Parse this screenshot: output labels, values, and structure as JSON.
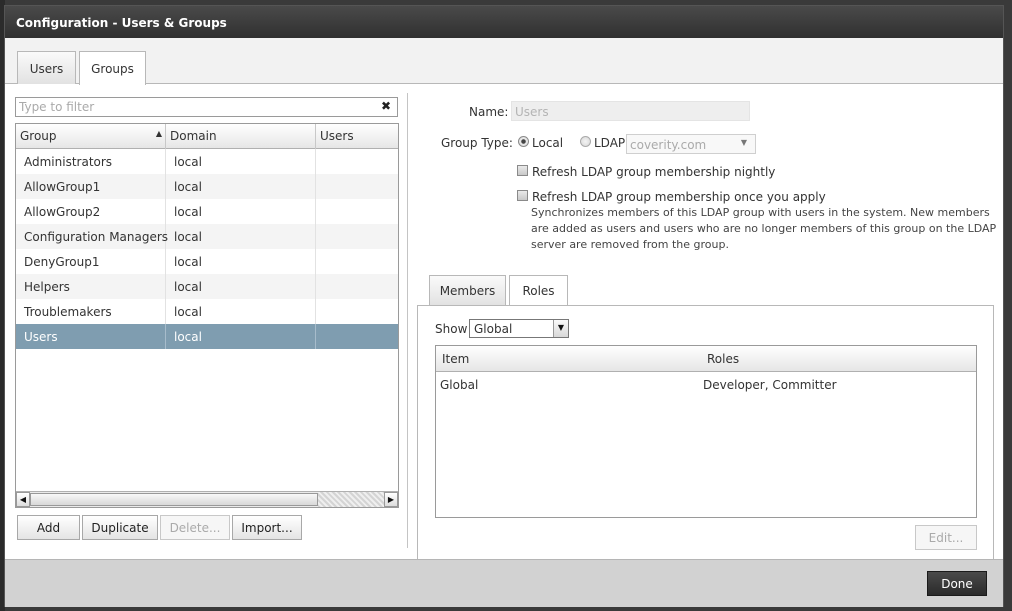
{
  "window": {
    "title": "Configuration - Users & Groups"
  },
  "tabs": [
    {
      "label": "Users",
      "active": false
    },
    {
      "label": "Groups",
      "active": true
    }
  ],
  "filter": {
    "placeholder": "Type to filter",
    "value": "",
    "clear_icon": "close-icon"
  },
  "groups_table": {
    "columns": [
      "Group",
      "Domain",
      "Users"
    ],
    "sort_column": "Group",
    "sort_direction": "ascending",
    "rows": [
      {
        "group": "Administrators",
        "domain": "local",
        "users": ""
      },
      {
        "group": "AllowGroup1",
        "domain": "local",
        "users": ""
      },
      {
        "group": "AllowGroup2",
        "domain": "local",
        "users": ""
      },
      {
        "group": "Configuration Managers",
        "domain": "local",
        "users": ""
      },
      {
        "group": "DenyGroup1",
        "domain": "local",
        "users": ""
      },
      {
        "group": "Helpers",
        "domain": "local",
        "users": ""
      },
      {
        "group": "Troublemakers",
        "domain": "local",
        "users": ""
      },
      {
        "group": "Users",
        "domain": "local",
        "users": "",
        "selected": true
      }
    ]
  },
  "actions": {
    "add": "Add",
    "duplicate": "Duplicate",
    "delete": "Delete...",
    "import": "Import..."
  },
  "details": {
    "name_label": "Name:",
    "name_value": "Users",
    "group_type_label": "Group Type:",
    "local_label": "Local",
    "ldap_label": "LDAP",
    "ldap_server": "coverity.com",
    "selected_type": "Local",
    "refresh_nightly_label": "Refresh LDAP group membership nightly",
    "refresh_apply_label": "Refresh LDAP group membership once you apply",
    "refresh_description": "Synchronizes members of this LDAP group with users in the system. New members are added as users and users who are no longer members of this group on the LDAP server are removed from the group."
  },
  "detail_tabs": [
    {
      "label": "Members",
      "active": false
    },
    {
      "label": "Roles",
      "active": true
    }
  ],
  "roles": {
    "show_label": "Show",
    "show_value": "Global",
    "columns": [
      "Item",
      "Roles"
    ],
    "rows": [
      {
        "item": "Global",
        "roles": "Developer, Committer"
      }
    ],
    "edit_label": "Edit..."
  },
  "footer": {
    "done_label": "Done"
  },
  "colors": {
    "titlebar": "#3a3a3a",
    "selected_row": "#7f9db0",
    "done_button": "#333333"
  }
}
